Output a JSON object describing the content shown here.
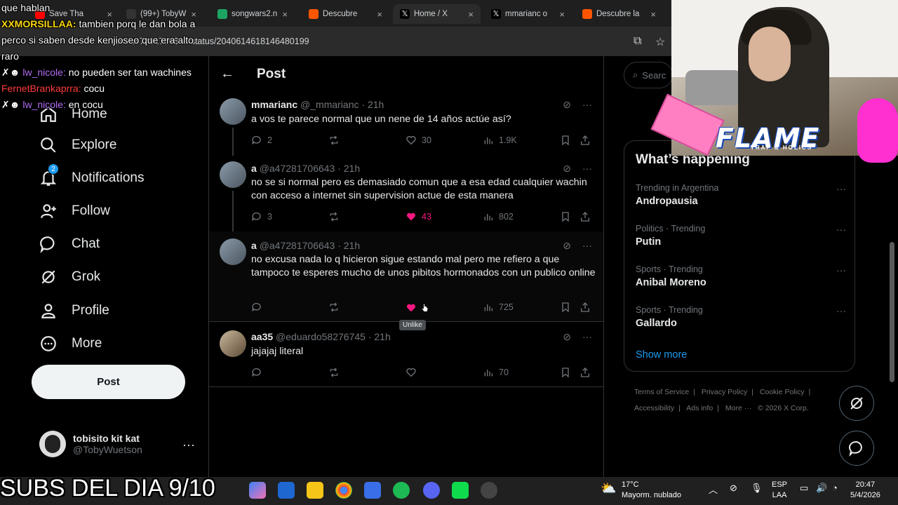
{
  "browser": {
    "tabs": [
      {
        "label": "Save Tha",
        "color": "#ff0000"
      },
      {
        "label": "(99+) TobyW",
        "color": "#111111"
      },
      {
        "label": "songwars2.n",
        "color": "#1da462"
      },
      {
        "label": "Descubre",
        "color": "#ff5500"
      },
      {
        "label": "Home / X",
        "color": "#000000"
      },
      {
        "label": "mmarianc o",
        "color": "#000000"
      },
      {
        "label": "Descubre la",
        "color": "#ff5500"
      }
    ],
    "url": "x.com/a47281706643/status/2040614618146480199"
  },
  "chat_overlay": [
    {
      "user": "",
      "text": "que hablan"
    },
    {
      "user": "XXMORSILLAA:",
      "text": " tambien porq le dan bola a perco si saben desde kenjioseo que era alto raro"
    },
    {
      "user": "lw_nicole:",
      "text": " no pueden ser tan wachines"
    },
    {
      "user": "FernetBrankaprra:",
      "text": " cocu"
    },
    {
      "user": "lw_nicole:",
      "text": " en cocu"
    }
  ],
  "nav": {
    "home": "Home",
    "explore": "Explore",
    "notifications": "Notifications",
    "notifications_badge": "2",
    "follow": "Follow",
    "chat": "Chat",
    "grok": "Grok",
    "profile": "Profile",
    "more": "More",
    "post_button": "Post",
    "account_name": "tobisito kit kat",
    "account_handle": "@TobyWuetson"
  },
  "main": {
    "title": "Post",
    "tweets": [
      {
        "name": "mmarianc",
        "meta": "@_mmarianc · 21h",
        "text": "a vos te parece normal que un nene de 14 años actúe así?",
        "replies": "2",
        "reposts": "",
        "likes": "30",
        "views": "1.9K",
        "liked": false
      },
      {
        "name": "a",
        "meta": "@a47281706643 · 21h",
        "text": "no se si normal pero es demasiado comun que a esa edad cualquier wachin con acceso a internet sin supervision actue de esta manera",
        "replies": "3",
        "reposts": "",
        "likes": "43",
        "views": "802",
        "liked": true
      },
      {
        "name": "a",
        "meta": "@a47281706643 · 21h",
        "text": "no excusa nada lo q hicieron sigue estando mal pero me refiero a que tampoco te esperes mucho de unos pibitos hormonados con un publico online",
        "replies": "",
        "reposts": "",
        "likes": "",
        "views": "725",
        "liked": true
      },
      {
        "name": "aa35",
        "meta": "@eduardo58276745 · 21h",
        "text": "jajajaj literal",
        "replies": "",
        "reposts": "",
        "likes": "",
        "views": "70",
        "liked": false
      }
    ],
    "tooltip": "Unlike"
  },
  "right": {
    "search_placeholder": "Searc",
    "happening_title": "What’s happening",
    "trends": [
      {
        "context": "Trending in Argentina",
        "name": "Andropausia"
      },
      {
        "context": "Politics · Trending",
        "name": "Putin"
      },
      {
        "context": "Sports · Trending",
        "name": "Anibal Moreno"
      },
      {
        "context": "Sports · Trending",
        "name": "Gallardo"
      }
    ],
    "show_more": "Show more",
    "footer": [
      "Terms of Service",
      "|",
      "Privacy Policy",
      "|",
      "Cookie Policy",
      "|",
      "Accessibility",
      "|",
      "Ads info",
      "|",
      "More ···",
      "© 2026 X Corp."
    ]
  },
  "stream": {
    "logo_text": "FLAME",
    "logo_sub": "TRAP & HOLICS",
    "subs_banner": "SUBS DEL DIA 9/10"
  },
  "taskbar": {
    "temperature": "17°C",
    "weather": "Mayorm. nublado",
    "lang_top": "ESP",
    "lang_bottom": "LAA",
    "time": "20:47",
    "date": "5/4/2026"
  }
}
